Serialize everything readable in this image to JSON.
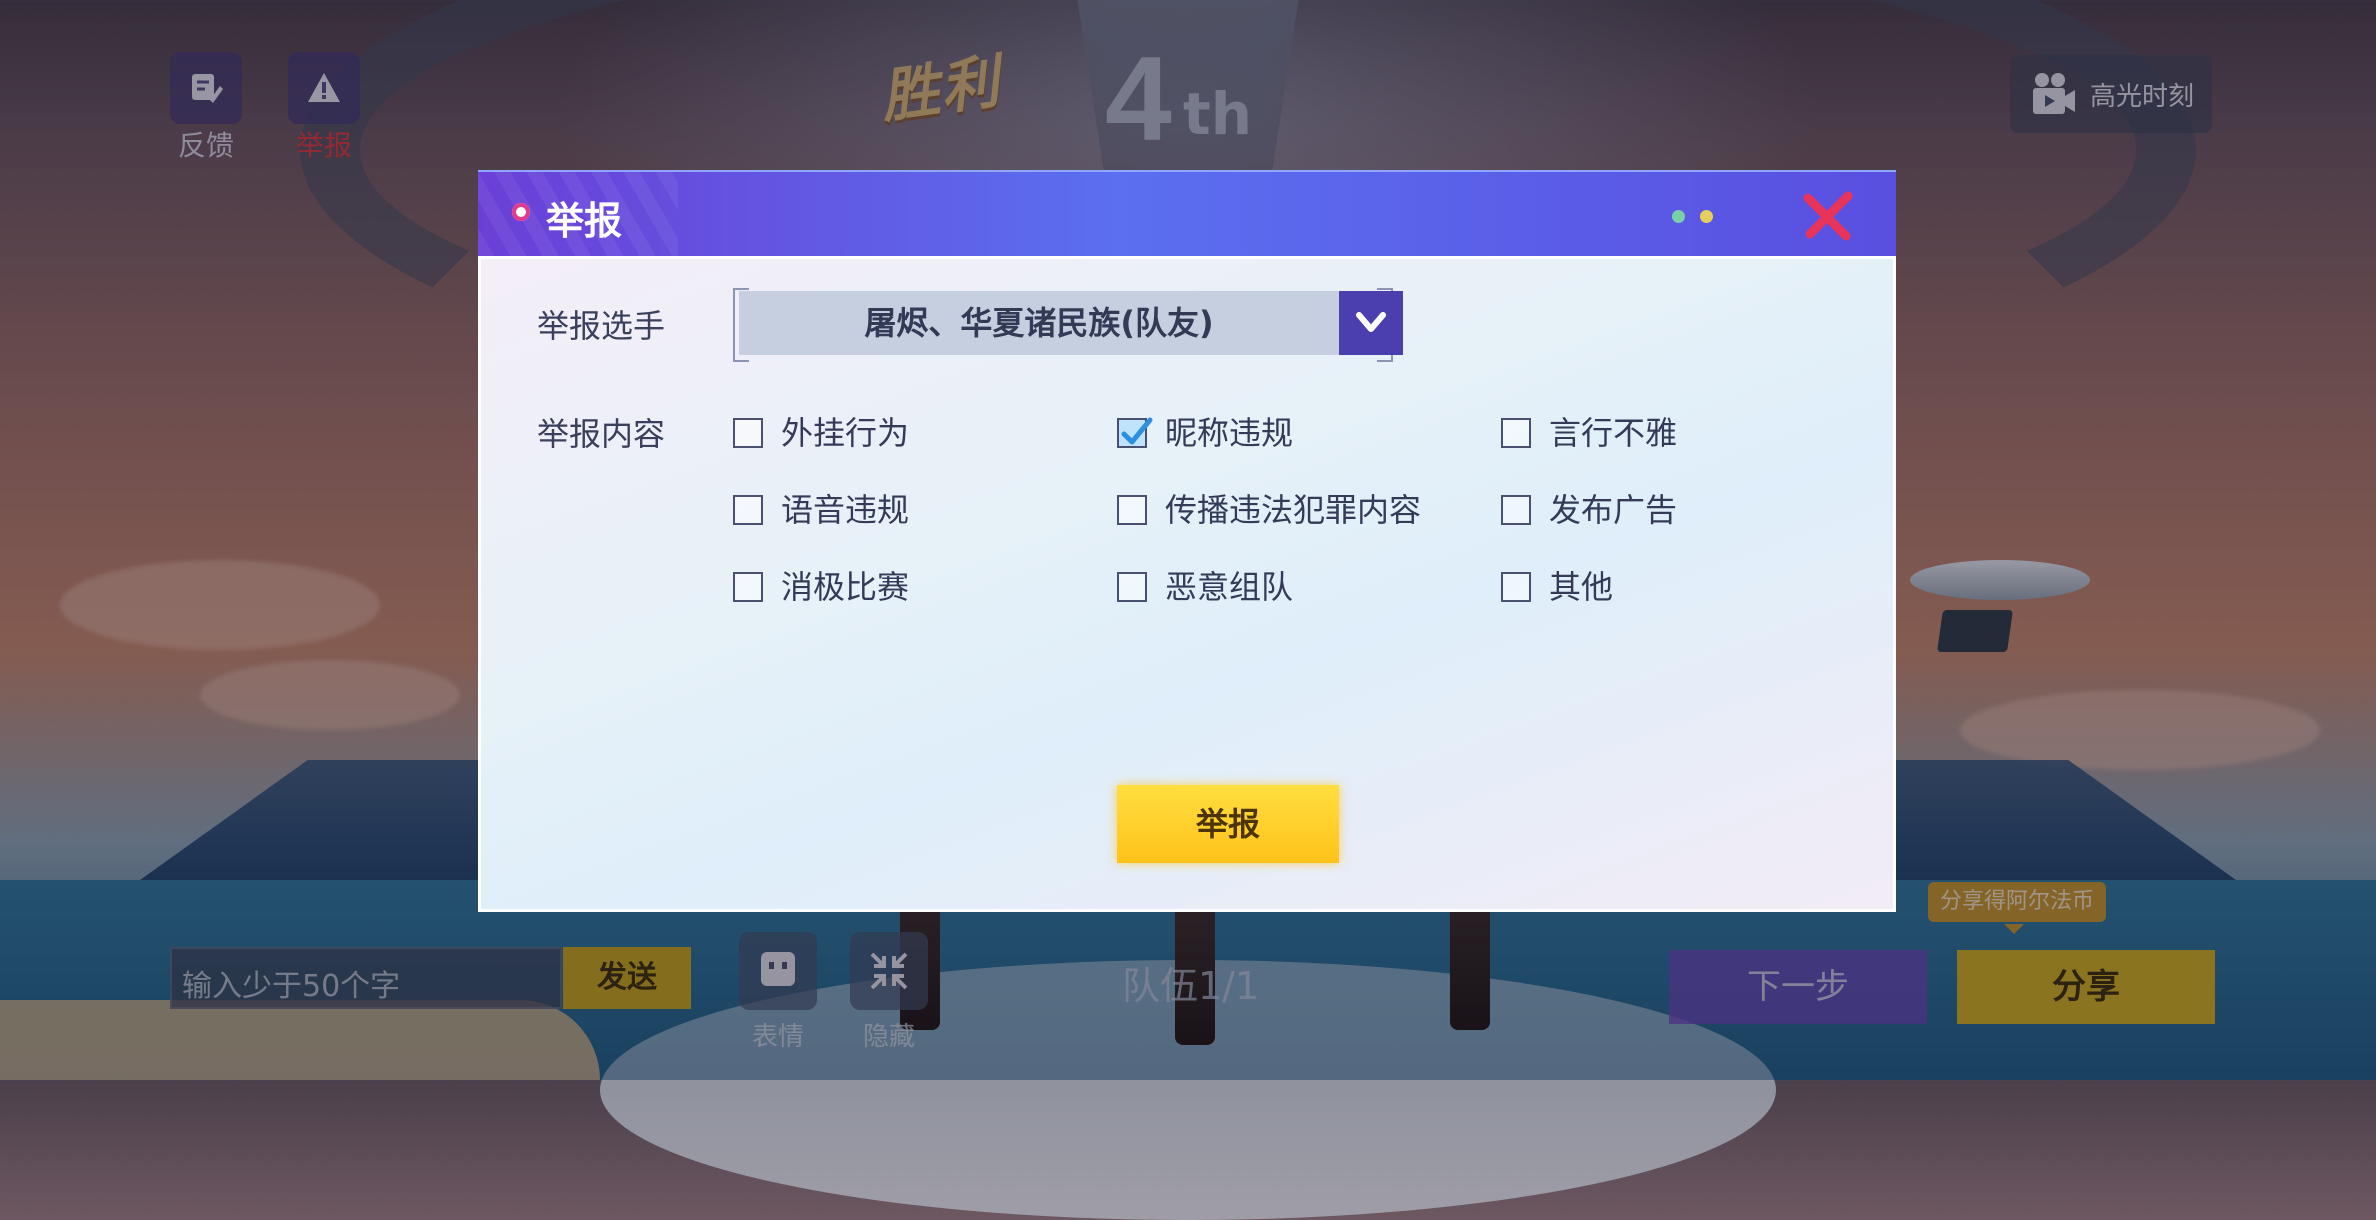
{
  "background": {
    "victory_text": "胜利",
    "rank_number": "4",
    "rank_suffix": "th",
    "highlight_label": "高光时刻",
    "feedback_label": "反馈",
    "report_top_label": "举报",
    "chat_placeholder": "输入少于50个字",
    "send_label": "发送",
    "emote_label": "表情",
    "hide_label": "隐藏",
    "team_count": "队伍1/1",
    "next_label": "下一步",
    "share_label": "分享",
    "share_tip": "分享得阿尔法币"
  },
  "dialog": {
    "title": "举报",
    "player_label": "举报选手",
    "selected_player": "屠烬、华夏诸民族(队友)",
    "content_label": "举报内容",
    "options": [
      {
        "label": "外挂行为",
        "checked": false
      },
      {
        "label": "昵称违规",
        "checked": true
      },
      {
        "label": "言行不雅",
        "checked": false
      },
      {
        "label": "语音违规",
        "checked": false
      },
      {
        "label": "传播违法犯罪内容",
        "checked": false
      },
      {
        "label": "发布广告",
        "checked": false
      },
      {
        "label": "消极比赛",
        "checked": false
      },
      {
        "label": "恶意组队",
        "checked": false
      },
      {
        "label": "其他",
        "checked": false
      }
    ],
    "submit_label": "举报"
  },
  "colors": {
    "header_start": "#6a3fd6",
    "header_end": "#5a4fe0",
    "submit": "#ffc21a",
    "close": "#e8335a",
    "feedback_text": "#d8d8e6",
    "report_text": "#e23a3a"
  },
  "icons": [
    "feedback-icon",
    "warning-icon",
    "video-camera-icon",
    "close-icon",
    "chevron-down-icon",
    "checkmark-icon",
    "emote-icon",
    "collapse-icon"
  ]
}
